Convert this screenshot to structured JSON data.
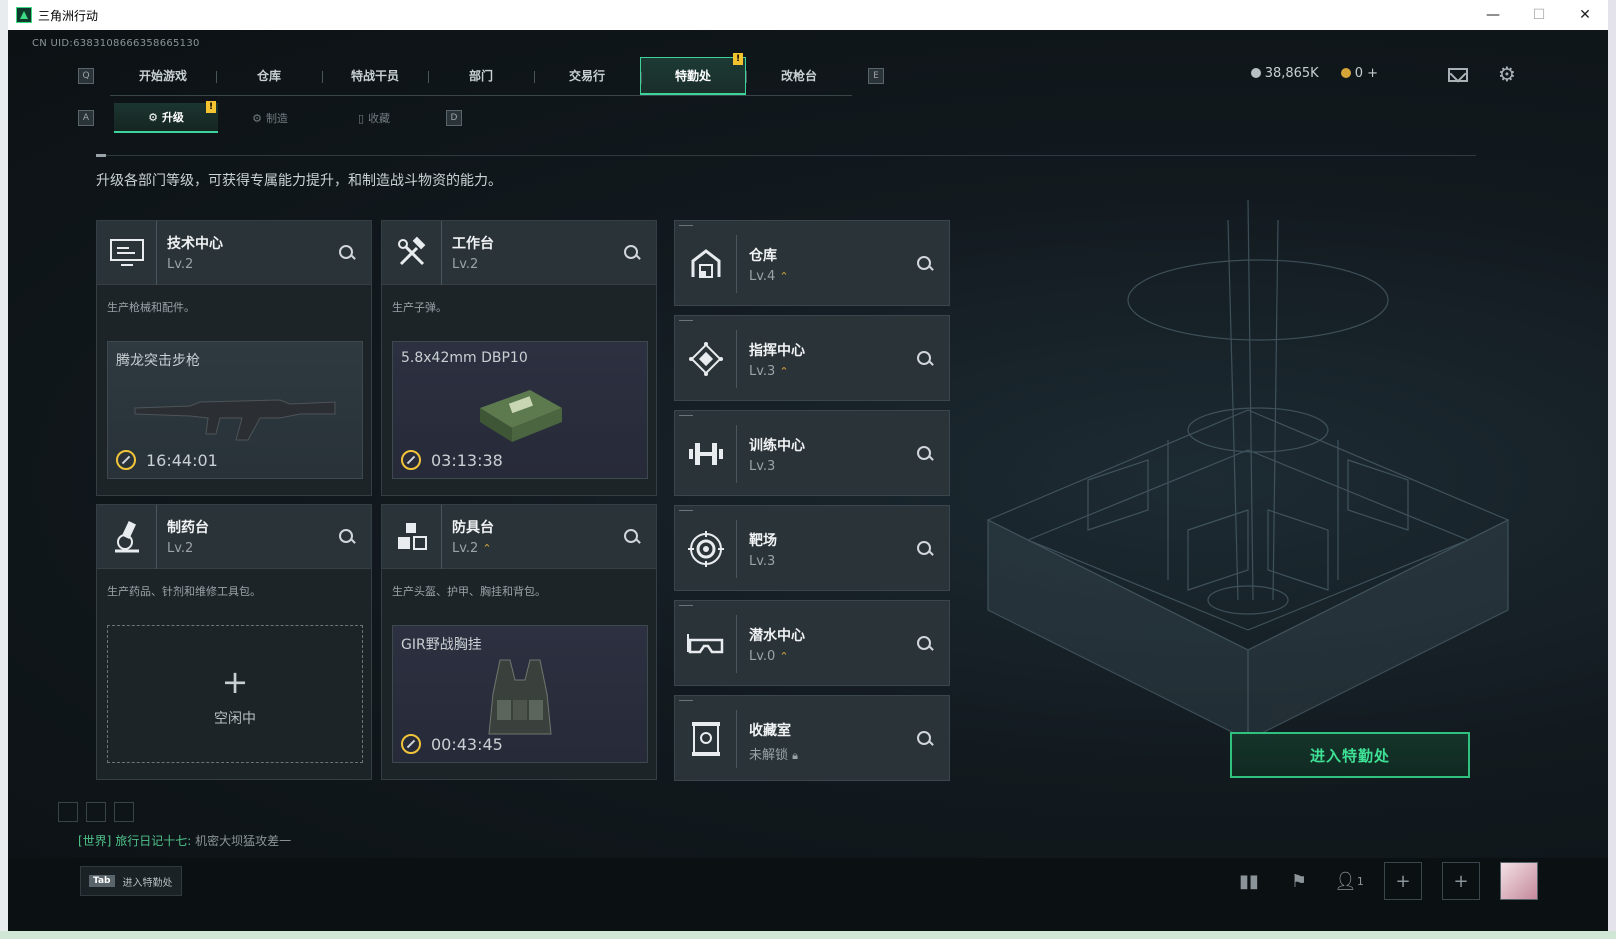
{
  "window": {
    "title": "三角洲行动",
    "min": "—",
    "max": "☐",
    "close": "✕"
  },
  "uid": "CN UID:6383108666358665130",
  "nav": {
    "left_key": "Q",
    "right_key": "E",
    "tabs": [
      "开始游戏",
      "仓库",
      "特战干员",
      "部门",
      "交易行",
      "特勤处",
      "改枪台"
    ],
    "active": "特勤处",
    "badge": "!"
  },
  "currency": {
    "silver": "38,865K",
    "gold": "0 +"
  },
  "subnav": {
    "left_key": "A",
    "right_key": "D",
    "tabs": [
      "升级",
      "制造",
      "收藏"
    ],
    "active": "升级",
    "badge": "!"
  },
  "description": "升级各部门等级，可获得专属能力提升，和制造战斗物资的能力。",
  "production": [
    {
      "name": "技术中心",
      "level": "Lv.2",
      "desc": "生产枪械和配件。",
      "item": "腾龙突击步枪",
      "timer": "16:44:01",
      "icon": "monitor-icon",
      "upgrade": false
    },
    {
      "name": "工作台",
      "level": "Lv.2",
      "desc": "生产子弹。",
      "item": "5.8x42mm DBP10",
      "timer": "03:13:38",
      "icon": "tools-icon",
      "upgrade": false
    },
    {
      "name": "制药台",
      "level": "Lv.2",
      "desc": "生产药品、针剂和维修工具包。",
      "item": "",
      "timer": "",
      "idle": "空闲中",
      "icon": "microscope-icon",
      "upgrade": false
    },
    {
      "name": "防具台",
      "level": "Lv.2",
      "desc": "生产头盔、护甲、胸挂和背包。",
      "item": "GIR野战胸挂",
      "timer": "00:43:45",
      "icon": "blocks-icon",
      "upgrade": true
    }
  ],
  "facilities": [
    {
      "name": "仓库",
      "level": "Lv.4",
      "upgrade": true,
      "icon": "warehouse-icon"
    },
    {
      "name": "指挥中心",
      "level": "Lv.3",
      "upgrade": true,
      "icon": "command-icon"
    },
    {
      "name": "训练中心",
      "level": "Lv.3",
      "upgrade": false,
      "icon": "dumbbell-icon"
    },
    {
      "name": "靶场",
      "level": "Lv.3",
      "upgrade": false,
      "icon": "target-icon"
    },
    {
      "name": "潜水中心",
      "level": "Lv.0",
      "upgrade": true,
      "icon": "goggles-icon"
    },
    {
      "name": "收藏室",
      "level": "未解锁",
      "upgrade": false,
      "locked": true,
      "icon": "vault-icon"
    }
  ],
  "enter_button": "进入特勤处",
  "chat": {
    "channel": "[世界]",
    "sender": "旅行日记十七:",
    "message": "机密大坝猛攻差一"
  },
  "tab_hint": {
    "key": "Tab",
    "label": "进入特勤处"
  },
  "friends_count": "1",
  "upgrade_glyph": "⌃"
}
